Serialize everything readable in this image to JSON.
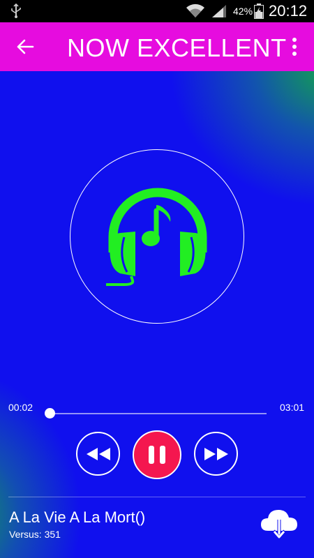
{
  "status_bar": {
    "battery": "42%",
    "time": "20:12"
  },
  "app_bar": {
    "title": "NOW EXCELLENT"
  },
  "player": {
    "current_time": "00:02",
    "total_time": "03:01",
    "progress": 0.01,
    "state": "playing"
  },
  "song": {
    "title": "A La Vie A La Mort()",
    "subtitle": "Versus: 351"
  },
  "colors": {
    "app_bar": "#e60cdf",
    "background": "#1010ee",
    "accent_green": "#22ee22",
    "pause_button": "#f4174f"
  },
  "icons": {
    "back": "arrow-left-icon",
    "more": "more-vertical-icon",
    "artwork": "headphones-music-icon",
    "rewind": "rewind-icon",
    "pause": "pause-icon",
    "forward": "fast-forward-icon",
    "download": "cloud-download-icon"
  }
}
